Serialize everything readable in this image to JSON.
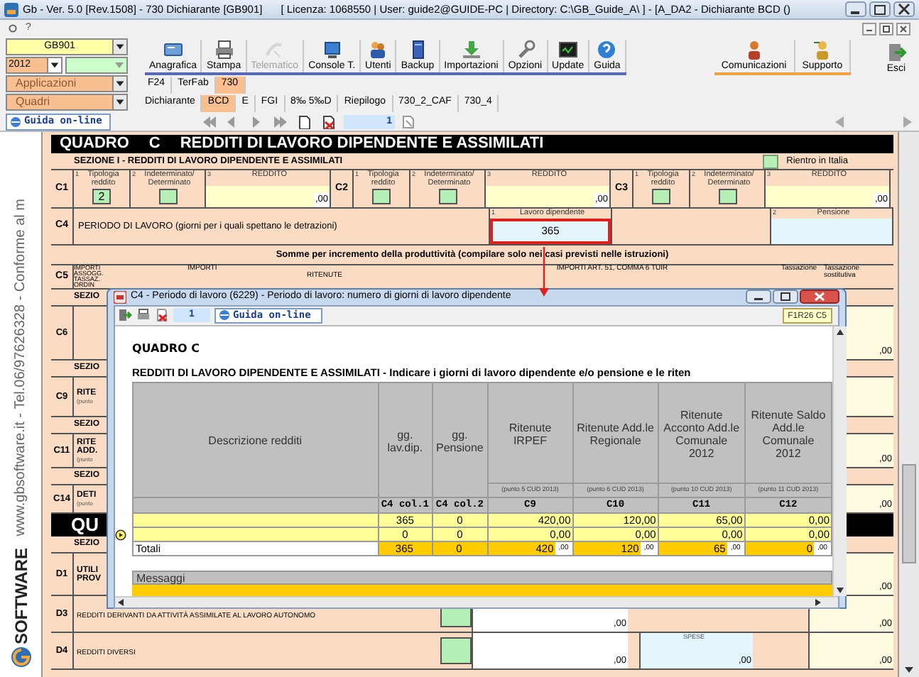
{
  "window": {
    "title": "Gb - Ver. 5.0 [Rev.1508] -  730 Dichiarante [GB901]",
    "info": "[ Licenza: 1068550 | User: guide2@GUIDE-PC | Directory: C:\\GB_Guide_A\\ ] - [A_DA2 - Dichiarante BCD ()"
  },
  "menu_bar": {
    "items": [
      "?"
    ]
  },
  "selectors": {
    "company": "GB901",
    "year": "2012",
    "applications": "Applicazioni",
    "quadri": "Quadri"
  },
  "toolbar": {
    "main": [
      {
        "label": "Anagrafica",
        "disabled": false
      },
      {
        "label": "Stampa",
        "disabled": false
      },
      {
        "label": "Telematico",
        "disabled": true
      },
      {
        "label": "Console T.",
        "disabled": false
      },
      {
        "label": "Utenti",
        "disabled": false
      },
      {
        "label": "Backup",
        "disabled": false
      },
      {
        "label": "Importazioni",
        "disabled": false
      },
      {
        "label": "Opzioni",
        "disabled": false
      },
      {
        "label": "Update",
        "disabled": false
      },
      {
        "label": "Guida",
        "disabled": false
      }
    ],
    "service": [
      {
        "label": "Comunicazioni"
      },
      {
        "label": "Supporto"
      }
    ],
    "exit": "Esci"
  },
  "application_tabs": [
    {
      "label": "F24",
      "selected": false
    },
    {
      "label": "TerFab",
      "selected": false
    },
    {
      "label": "730",
      "selected": true
    }
  ],
  "quadri_tabs": [
    {
      "label": "Dichiarante",
      "selected": false
    },
    {
      "label": "BCD",
      "selected": true
    },
    {
      "label": "E",
      "selected": false
    },
    {
      "label": "FGI",
      "selected": false
    },
    {
      "label": "8‰  5‰D",
      "selected": false
    },
    {
      "label": "Riepilogo",
      "selected": false
    },
    {
      "label": "730_2_CAF",
      "selected": false
    },
    {
      "label": "730_4",
      "selected": false
    }
  ],
  "navigation": {
    "help_button": "Guida on-line",
    "page": "1"
  },
  "side_banner": {
    "text": "www.gbsoftware.it - Tel.06/97626328 - Conforme al m",
    "logo": "SOFTWARE"
  },
  "form": {
    "quadro": "QUADRO",
    "letter": "C",
    "title": "REDDITI DI LAVORO DIPENDENTE E ASSIMILATI",
    "section": {
      "title": "SEZIONE I -  REDDITI DI LAVORO DIPENDENTE E ASSIMILATI",
      "checkbox_label": "Rientro in Italia",
      "checked": false
    },
    "income_rows": [
      {
        "code": "C1",
        "cells": [
          {
            "num": "1",
            "label": "Tipologia reddito",
            "value": "2"
          },
          {
            "num": "2",
            "label": "Indeterminato/ Determinato"
          },
          {
            "num": "3",
            "label": "REDDITO",
            "value": ",00"
          }
        ]
      },
      {
        "code": "C2",
        "cells": [
          {
            "num": "1",
            "label": "Tipologia reddito"
          },
          {
            "num": "2",
            "label": "Indeterminato/ Determinato"
          },
          {
            "num": "3",
            "label": "REDDITO",
            "value": ",00"
          }
        ]
      },
      {
        "code": "C3",
        "cells": [
          {
            "num": "1",
            "label": "Tipologia reddito"
          },
          {
            "num": "2",
            "label": "Indeterminato/ Determinato"
          },
          {
            "num": "3",
            "label": "REDDITO",
            "value": ",00"
          }
        ]
      }
    ],
    "period": {
      "code": "C4",
      "label": "PERIODO DI LAVORO (giorni per i quali spettano le detrazioni)",
      "employment": {
        "num": "1",
        "label": "Lavoro dipendente",
        "value": "365",
        "highlighted": true
      },
      "pension": {
        "num": "2",
        "label": "Pensione"
      }
    },
    "productivity": {
      "title": "Somme per incremento della produttività (compilare solo nei casi previsti nelle istruzioni)",
      "code": "C5",
      "first_label": "IMPORTI ASSOGG. TASSAZ. ORDIN",
      "labels": [
        "IMPORTI",
        "RITENUTE",
        "IMPORTI ART. 51, COMMA 6 TUIR",
        "Tassazione",
        "Tassazione sostitutiva"
      ]
    },
    "lower_rows": [
      {
        "kind": "section",
        "text": "SEZIO"
      },
      {
        "kind": "line",
        "code": "C6",
        "amount": ",00"
      },
      {
        "kind": "section",
        "text": "SEZIO"
      },
      {
        "kind": "line",
        "code": "C9",
        "text": "RITE",
        "note": "(punto"
      },
      {
        "kind": "section",
        "text": "SEZIO"
      },
      {
        "kind": "line",
        "code": "C11",
        "text": "RITE ADD.",
        "note": "(punto",
        "amount": ",00"
      },
      {
        "kind": "section",
        "text": "SEZIO"
      },
      {
        "kind": "line",
        "code": "C14",
        "text": "DETI",
        "note": "(punto",
        "amount": ",00"
      },
      {
        "kind": "heading",
        "text": "QU"
      },
      {
        "kind": "section",
        "text": "SEZIO"
      },
      {
        "kind": "line",
        "code": "D1",
        "text": "UTILI PROV",
        "amount": ",00"
      },
      {
        "kind": "wide",
        "code": "D3",
        "text": "REDDITI DERIVANTI DA ATTIVITÀ ASSIMILATE AL LAVORO AUTONOMO",
        "amounts": [
          ",00",
          ",00"
        ]
      },
      {
        "kind": "wide",
        "code": "D4",
        "text": "REDDITI DIVERSI",
        "note": "SPESE",
        "amounts": [
          ",00",
          ",00",
          ",00"
        ]
      }
    ]
  },
  "dialog": {
    "title": "C4 - Periodo di lavoro (6229) - Periodo di lavoro: numero di giorni di lavoro dipendente",
    "page": "1",
    "help_button": "Guida on-line",
    "position_code": "F1R26 C5",
    "heading": "QUADRO C",
    "subheading": "REDDITI DI LAVORO DIPENDENTE E ASSIMILATI - Indicare i giorni di lavoro dipendente e/o pensione e le riten",
    "table": {
      "columns": [
        {
          "label": "Descrizione redditi"
        },
        {
          "label": "gg. lav.dip.",
          "code": "C4 col.1"
        },
        {
          "label": "gg. Pensione",
          "code": "C4 col.2"
        },
        {
          "label": "Ritenute IRPEF",
          "note": "(punto 5 CUD 2013)",
          "code": "C9"
        },
        {
          "label": "Ritenute Add.le Regionale",
          "note": "(punto 6 CUD 2013)",
          "code": "C10"
        },
        {
          "label": "Ritenute Acconto Add.le Comunale 2012",
          "note": "(punto 10 CUD 2013)",
          "code": "C11"
        },
        {
          "label": "Ritenute Saldo Add.le Comunale 2012",
          "note": "(punto 11 CUD 2013)",
          "code": "C12"
        }
      ],
      "rows": [
        {
          "selected": false,
          "cells": [
            "",
            "365",
            "0",
            "420,00",
            "120,00",
            "65,00",
            "0,00"
          ]
        },
        {
          "selected": true,
          "cells": [
            "",
            "0",
            "0",
            "0,00",
            "0,00",
            "0,00",
            "0,00"
          ]
        }
      ],
      "totals": {
        "label": "Totali",
        "cells": [
          {
            "value": "365"
          },
          {
            "value": "0"
          },
          {
            "value": "420",
            "decimals": ",00"
          },
          {
            "value": "120",
            "decimals": ",00"
          },
          {
            "value": "65",
            "decimals": ",00"
          },
          {
            "value": "0",
            "decimals": ",00"
          }
        ]
      }
    },
    "messages_label": "Messaggi"
  }
}
